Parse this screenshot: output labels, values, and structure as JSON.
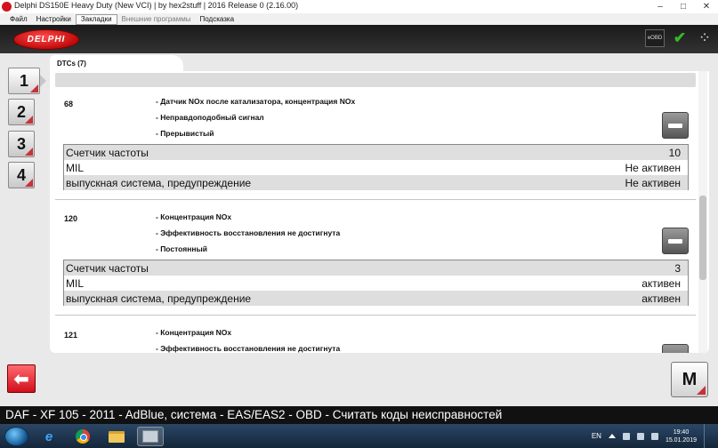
{
  "window": {
    "title": "Delphi DS150E Heavy Duty (New VCI) | by hex2stuff | 2016 Release 0 (2.16.00)",
    "controls": [
      "–",
      "□",
      "✕"
    ]
  },
  "menu": [
    {
      "label": "Файл",
      "state": "normal"
    },
    {
      "label": "Настройки",
      "state": "normal"
    },
    {
      "label": "Закладки",
      "state": "active"
    },
    {
      "label": "Внешние программы",
      "state": "disabled"
    },
    {
      "label": "Подсказка",
      "state": "normal"
    }
  ],
  "header": {
    "logo": "DELPHI",
    "icons": {
      "obd": "eOBD",
      "vci_status": "check-icon",
      "busy": "spinner-icon"
    }
  },
  "side_buttons": [
    "1",
    "2",
    "3",
    "4"
  ],
  "tab": {
    "label": "DTCs (7)"
  },
  "dtcs": [
    {
      "code": "68",
      "descriptions": [
        "- Датчик NOx после катализатора, концентрация NOx",
        "- Неправдоподобный сигнал",
        "- Прерывистый"
      ],
      "info": [
        {
          "label": "Счетчик частоты",
          "value": "10"
        },
        {
          "label": "MIL",
          "value": "Не активен"
        },
        {
          "label": "выпускная система, предупреждение",
          "value": "Не активен"
        }
      ]
    },
    {
      "code": "120",
      "descriptions": [
        "- Концентрация NOx",
        "- Эффективность восстановления не достигнута",
        "- Постоянный"
      ],
      "info": [
        {
          "label": "Счетчик частоты",
          "value": "3"
        },
        {
          "label": "MIL",
          "value": "активен"
        },
        {
          "label": "выпускная система, предупреждение",
          "value": "активен"
        }
      ]
    },
    {
      "code": "121",
      "descriptions": [
        "- Концентрация NOx",
        "- Эффективность восстановления не достигнута"
      ]
    }
  ],
  "m_button": "M",
  "status": {
    "text": "DAF - XF 105 - 2011 - AdBlue, система - EAS/EAS2 - OBD - Считать коды неисправностей"
  },
  "taskbar": {
    "apps": [
      "ie-icon",
      "chrome-icon",
      "explorer-icon",
      "delphi-app-icon"
    ],
    "lang": "EN",
    "time": "19:40",
    "date": "15.01.2019"
  },
  "colors": {
    "brand_red": "#d3121b",
    "header_dark": "#1a1a1a",
    "status_bar": "#111111",
    "check_green": "#35b82a"
  }
}
